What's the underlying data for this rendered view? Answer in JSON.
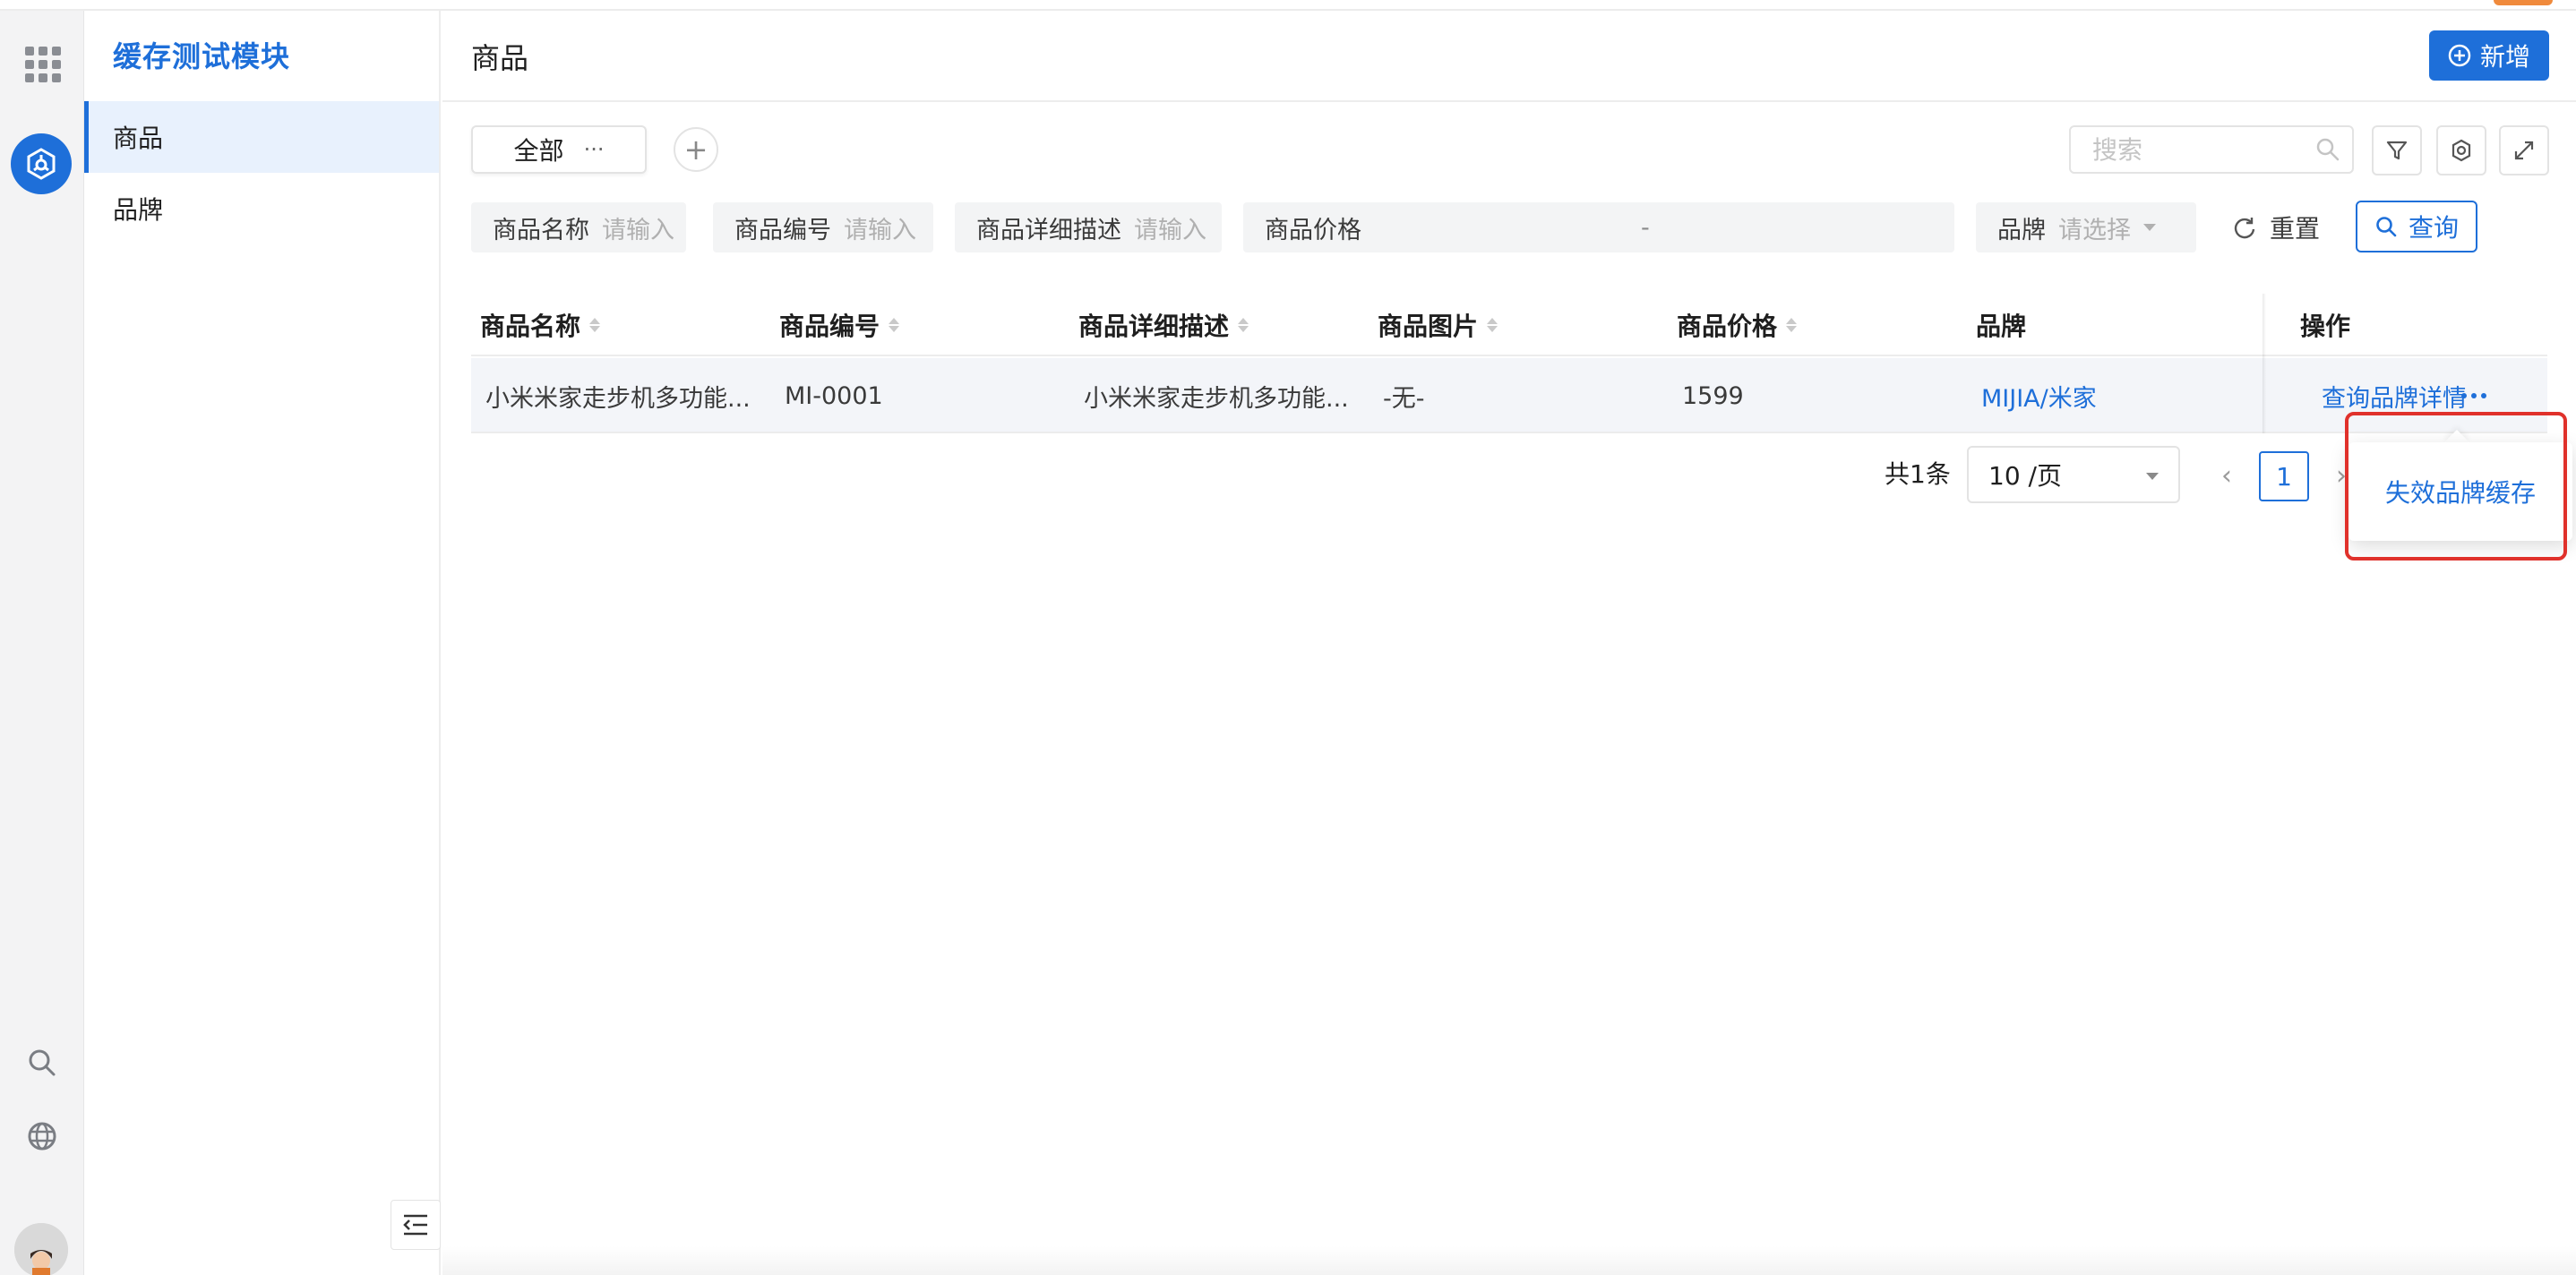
{
  "colors": {
    "primary": "#1e6fd9",
    "highlight": "#e0312b",
    "accent": "#f08a3c"
  },
  "rail": {
    "icons": [
      "apps-grid-icon",
      "module-icon",
      "search-icon",
      "globe-icon",
      "avatar"
    ]
  },
  "sidebar": {
    "title": "缓存测试模块",
    "items": [
      {
        "label": "商品",
        "active": true
      },
      {
        "label": "品牌",
        "active": false
      }
    ]
  },
  "header": {
    "title": "商品",
    "new_label": "新增"
  },
  "views": {
    "tab_label": "全部",
    "tab_more": "···",
    "add_label": "+"
  },
  "search": {
    "placeholder": "搜索",
    "value": ""
  },
  "filters": {
    "name": {
      "label": "商品名称",
      "placeholder": "请输入"
    },
    "code": {
      "label": "商品编号",
      "placeholder": "请输入"
    },
    "desc": {
      "label": "商品详细描述",
      "placeholder": "请输入"
    },
    "price": {
      "label": "商品价格",
      "separator": "-"
    },
    "brand": {
      "label": "品牌",
      "placeholder": "请选择"
    },
    "reset_label": "重置",
    "query_label": "查询"
  },
  "table": {
    "columns": [
      "商品名称",
      "商品编号",
      "商品详细描述",
      "商品图片",
      "商品价格",
      "品牌",
      "操作"
    ],
    "rows": [
      {
        "name": "小米米家走步机多功能...",
        "code": "MI-0001",
        "desc": "小米米家走步机多功能...",
        "image": "-无-",
        "price": "1599",
        "brand": "MIJIA/米家",
        "action": "查询品牌详情"
      }
    ]
  },
  "pagination": {
    "total": "共1条",
    "page_size": "10 /页",
    "current": "1",
    "prev": "‹",
    "next": "›"
  },
  "popover": {
    "item": "失效品牌缓存"
  }
}
